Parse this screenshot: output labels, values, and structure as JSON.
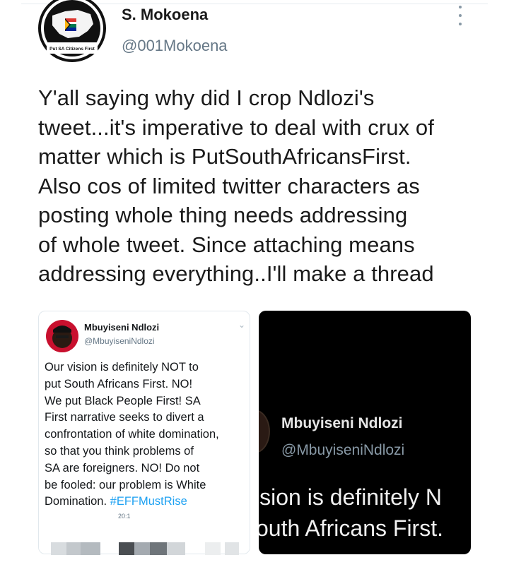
{
  "author": {
    "name": "S. Mokoena",
    "handle": "@001Mokoena",
    "avatar_label": "Put SA Citizens First"
  },
  "tweet": {
    "lines": [
      "Y'all saying why did I crop Ndlozi's",
      "tweet...it's imperative to deal with crux of",
      "matter which is PutSouthAfricansFirst.",
      "Also cos of limited twitter characters as",
      "posting whole thing needs addressing",
      "of whole tweet. Since attaching means",
      "addressing everything..I'll make a thread"
    ]
  },
  "quoted_left": {
    "name": "Mbuyiseni Ndlozi",
    "handle": "@MbuyiseniNdlozi",
    "lines": [
      "Our vision is definitely NOT to",
      "put South Africans First. NO!",
      "We put Black People First! SA",
      "First narrative seeks to divert a",
      "confrontation of white domination,",
      "so that you think problems of",
      "SA are foreigners. NO! Do not",
      "be fooled: our problem is White"
    ],
    "last_line_prefix": "Domination. ",
    "hashtag": "#EFFMustRise",
    "cut_text": "20:1"
  },
  "quoted_right": {
    "name": "Mbuyiseni Ndlozi",
    "handle": "@MbuyiseniNdlozi",
    "line1": "ision is definitely N",
    "line2": "outh Africans First."
  },
  "colors": {
    "link": "#1da1f2",
    "secondary": "#657786"
  }
}
